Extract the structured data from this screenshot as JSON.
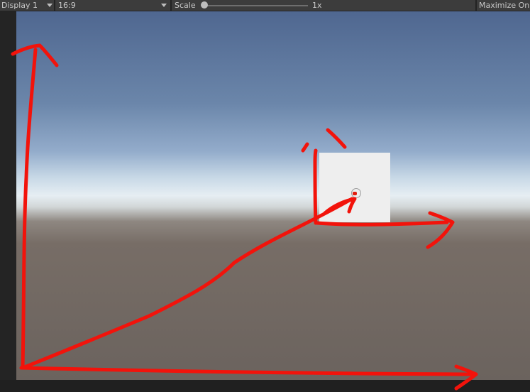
{
  "toolbar": {
    "display_label": "Display 1",
    "aspect_label": "16:9",
    "scale_label": "Scale",
    "scale_value": "1x",
    "scale_slider_level": 0.0,
    "maximize_label": "Maximize On Play"
  },
  "icons": {
    "dropdown_caret": "chevron-down-icon",
    "slider_thumb": "slider-thumb"
  },
  "colors": {
    "annotation_stroke": "#f2130b",
    "cube_face": "#eeeeee",
    "ground": "#6b635e",
    "sky_top": "#4f6790",
    "horizon": "#e6eef3"
  }
}
